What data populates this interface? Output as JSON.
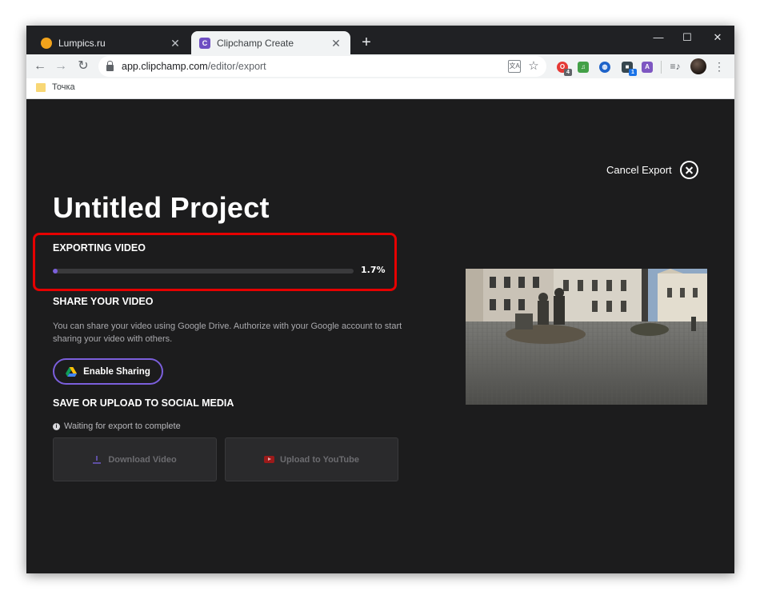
{
  "browser": {
    "tabs": [
      {
        "title": "Lumpics.ru",
        "favicon": "lumpics-favicon",
        "active": false
      },
      {
        "title": "Clipchamp Create",
        "favicon": "clipchamp-favicon",
        "favicon_letter": "C",
        "active": true
      }
    ],
    "new_tab_symbol": "+",
    "window_controls": {
      "minimize": "—",
      "maximize": "☐",
      "close": "✕"
    },
    "nav": {
      "back": "←",
      "forward": "→",
      "reload": "↻"
    },
    "url": {
      "host": "app.clipchamp.com",
      "path": "/editor/export"
    },
    "extension_badges": {
      "red": "4",
      "cube": "1"
    },
    "bookmarks": [
      {
        "label": "Точка",
        "icon": "folder-icon"
      }
    ]
  },
  "page": {
    "cancel_export_label": "Cancel Export",
    "project_title": "Untitled Project",
    "export": {
      "heading": "EXPORTING VIDEO",
      "progress_percent": 1.7,
      "progress_label": "1.7%",
      "highlight_color": "#e60000",
      "accent_color": "#7b5fdc"
    },
    "share": {
      "heading": "SHARE YOUR VIDEO",
      "description": "You can share your video using Google Drive. Authorize with your Google account to start sharing your video with others.",
      "button_label": "Enable Sharing",
      "button_icon": "google-drive-icon"
    },
    "social": {
      "heading": "SAVE OR UPLOAD TO SOCIAL MEDIA",
      "status": "Waiting for export to complete",
      "download_label": "Download Video",
      "youtube_label": "Upload to YouTube"
    }
  }
}
